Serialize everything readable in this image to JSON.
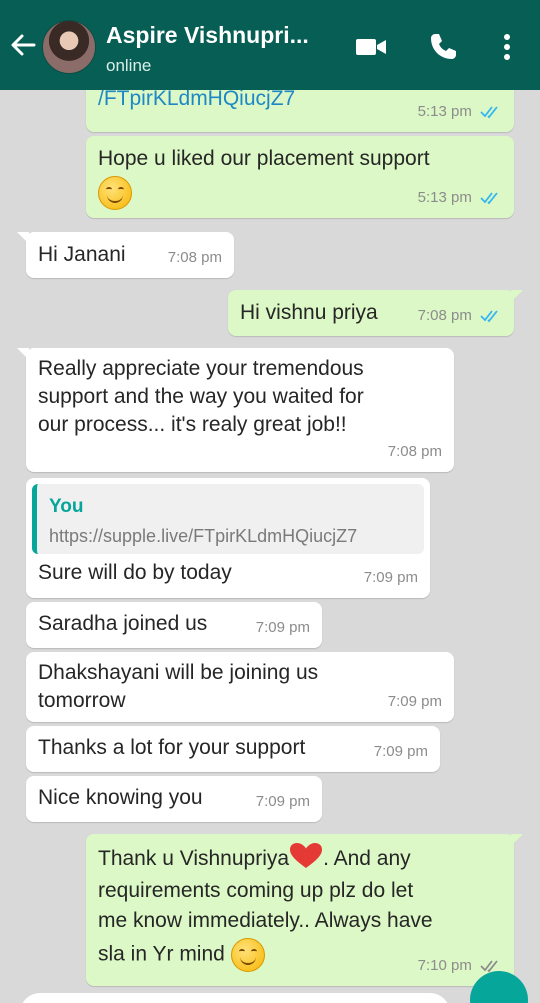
{
  "header": {
    "contact_name": "Aspire Vishnupri...",
    "status": "online"
  },
  "messages": [
    {
      "side": "out",
      "text": "/FTpirKLdmHQiucjZ7",
      "time": "5:13 pm",
      "ticks": "read"
    },
    {
      "side": "out",
      "text": "Hope u liked our placement support",
      "emoji": "smiling-face",
      "time": "5:13 pm",
      "ticks": "read"
    },
    {
      "side": "in",
      "text": "Hi Janani",
      "time": "7:08 pm"
    },
    {
      "side": "out",
      "text": "Hi vishnu priya",
      "time": "7:08 pm",
      "ticks": "read"
    },
    {
      "side": "in",
      "lines": [
        "Really appreciate your tremendous",
        "support and the way you waited for",
        "our process... it's realy great job!!"
      ],
      "time": "7:08 pm"
    },
    {
      "side": "in",
      "quote_author": "You",
      "quote_text": "https://supple.live/FTpirKLdmHQiucjZ7",
      "text": "Sure will do by today",
      "time": "7:09 pm"
    },
    {
      "side": "in",
      "text": "Saradha joined us",
      "time": "7:09 pm"
    },
    {
      "side": "in",
      "lines": [
        "Dhakshayani will be joining us",
        "tomorrow"
      ],
      "time": "7:09 pm"
    },
    {
      "side": "in",
      "text": "Thanks a lot for your support",
      "time": "7:09 pm"
    },
    {
      "side": "in",
      "text": "Nice knowing you",
      "time": "7:09 pm"
    },
    {
      "side": "out",
      "lines": [
        "Thank u Vishnupriya",
        ". And any",
        "requirements coming up plz do let",
        "me know immediately.. Always have",
        "sla in Yr mind"
      ],
      "emoji": "smiling-face",
      "heart": "red-heart",
      "time": "7:10 pm",
      "ticks": "delivered"
    }
  ],
  "colors": {
    "header": "#075e54",
    "outgoing": "#dcf8c6",
    "incoming": "#ffffff",
    "read_ticks": "#34b7f1",
    "quote_accent": "#06a69b"
  }
}
